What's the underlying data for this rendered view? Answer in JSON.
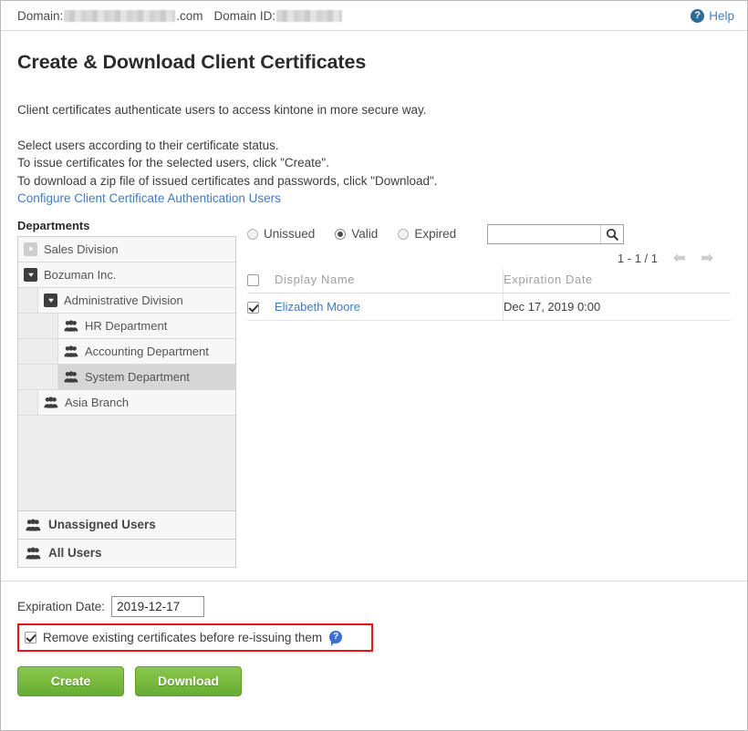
{
  "topbar": {
    "domain_label": "Domain:",
    "domain_suffix": ".com",
    "domain_id_label": "Domain ID:",
    "domain_value_redacted": "",
    "domain_id_value_redacted": "",
    "help_label": "Help",
    "help_icon": "question-circle-icon",
    "help_icon_glyph": "?",
    "help_color": "#4a7ebb"
  },
  "page": {
    "title": "Create & Download Client Certificates",
    "intro_line1": "Client certificates authenticate users to access kintone in more secure way.",
    "intro_line2": "Select users according to their certificate status.",
    "intro_line3": "To issue certificates for the selected users, click \"Create\".",
    "intro_line4": "To download a zip file of issued certificates and passwords, click \"Download\".",
    "configure_link": "Configure Client Certificate Authentication Users"
  },
  "departments": {
    "caption": "Departments",
    "tree": [
      {
        "label": "Sales Division",
        "depth": 0,
        "toggle": "collapsed",
        "icon": "",
        "selected": false
      },
      {
        "label": "Bozuman Inc.",
        "depth": 0,
        "toggle": "expanded",
        "icon": "",
        "selected": false
      },
      {
        "label": "Administrative Division",
        "depth": 1,
        "toggle": "expanded",
        "icon": "",
        "selected": false
      },
      {
        "label": "HR Department",
        "depth": 2,
        "toggle": "",
        "icon": "group-icon",
        "selected": false
      },
      {
        "label": "Accounting Department",
        "depth": 2,
        "toggle": "",
        "icon": "group-icon",
        "selected": false
      },
      {
        "label": "System Department",
        "depth": 2,
        "toggle": "",
        "icon": "group-icon",
        "selected": true
      },
      {
        "label": "Asia Branch",
        "depth": 1,
        "toggle": "",
        "icon": "group-icon",
        "selected": false
      }
    ],
    "footers": [
      {
        "label": "Unassigned Users",
        "icon": "group-icon"
      },
      {
        "label": "All Users",
        "icon": "group-icon"
      }
    ]
  },
  "filters": {
    "radios": [
      {
        "label": "Unissued",
        "selected": false
      },
      {
        "label": "Valid",
        "selected": true
      },
      {
        "label": "Expired",
        "selected": false
      }
    ],
    "search_value": "",
    "search_placeholder": "",
    "search_icon": "magnifier-icon"
  },
  "pager": {
    "range_text": "1 - 1 / 1",
    "prev_icon": "arrow-left-icon",
    "next_icon": "arrow-right-icon",
    "prev_enabled": false,
    "next_enabled": false
  },
  "table": {
    "headers": {
      "select_all": "",
      "display_name": "Display Name",
      "expiration_date": "Expiration Date"
    },
    "select_all_checked": false,
    "rows": [
      {
        "checked": true,
        "display_name": "Elizabeth Moore",
        "expiration_date": "Dec 17, 2019 0:00"
      }
    ]
  },
  "footer": {
    "expiration_label": "Expiration Date:",
    "expiration_value": "2019-12-17",
    "remove_checkbox_label": "Remove existing certificates before re-issuing them",
    "remove_checkbox_checked": true,
    "tooltip_icon": "help-tooltip-icon",
    "tooltip_glyph": "?",
    "highlight_color": "#ee1111",
    "create_label": "Create",
    "download_label": "Download",
    "button_color": "#7ac943"
  }
}
